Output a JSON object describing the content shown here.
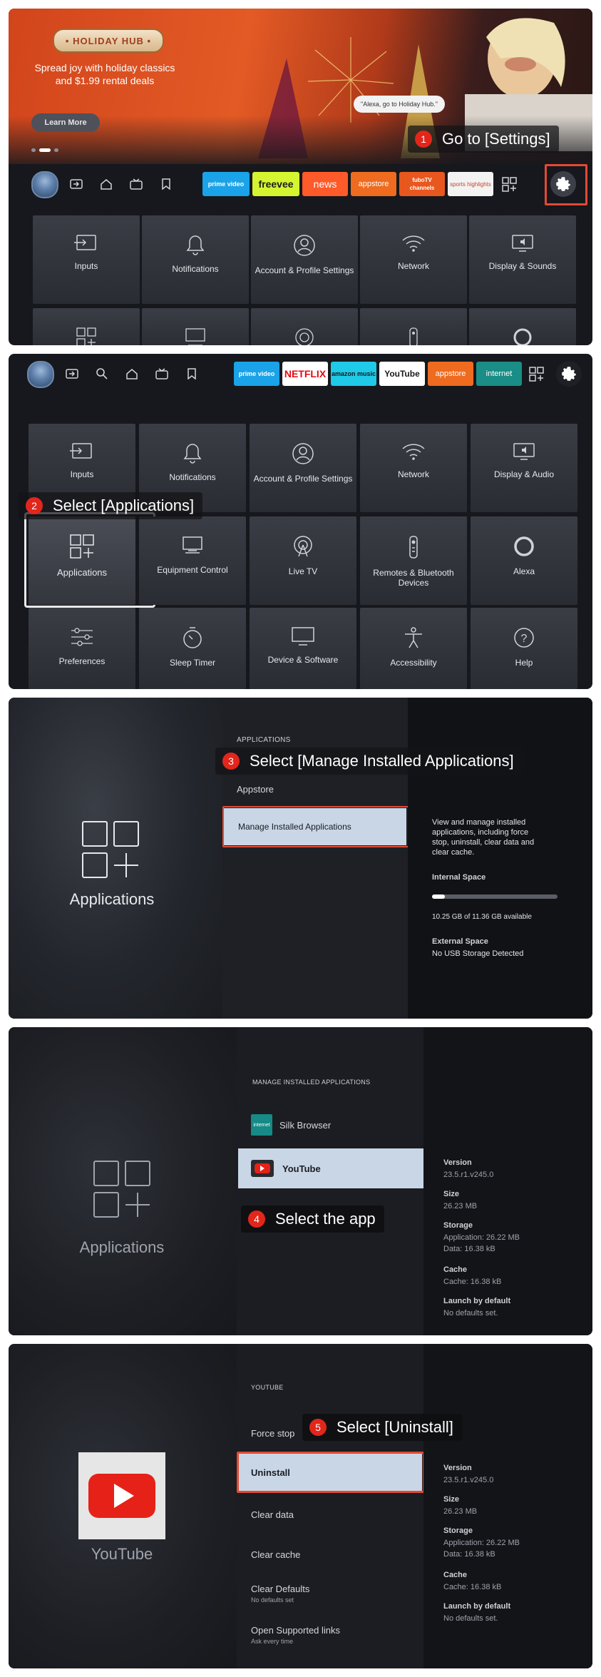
{
  "hero": {
    "badge": "• HOLIDAY HUB •",
    "subtitle_line1": "Spread joy with holiday classics",
    "subtitle_line2": "and $1.99 rental deals",
    "learn_more": "Learn More",
    "bubble": "\"Alexa, go to Holiday Hub.\""
  },
  "steps": [
    {
      "num": "1",
      "text": "Go to [Settings]"
    },
    {
      "num": "2",
      "text": "Select [Applications]"
    },
    {
      "num": "3",
      "text": "Select [Manage Installed Applications]"
    },
    {
      "num": "4",
      "text": "Select the app"
    },
    {
      "num": "5",
      "text": "Select [Uninstall]"
    }
  ],
  "nav1": {
    "chips": [
      {
        "label": "prime video",
        "color": "#1aa3e8"
      },
      {
        "label": "freevee",
        "color": "#d4f52f"
      },
      {
        "label": "news",
        "color": "#ff5a2a"
      },
      {
        "label": "appstore",
        "color": "#ee6b1f"
      },
      {
        "label": "fuboTV channels",
        "color": "#e8571e"
      },
      {
        "label": "sports highlights",
        "color": "#f3f3f3"
      }
    ]
  },
  "nav2": {
    "chips": [
      {
        "label": "prime video",
        "color": "#1aa3e8"
      },
      {
        "label": "NETFLIX",
        "color": "#ffffff"
      },
      {
        "label": "amazon music",
        "color": "#1fc9e8"
      },
      {
        "label": "YouTube",
        "color": "#ffffff"
      },
      {
        "label": "appstore",
        "color": "#ee6b1f"
      },
      {
        "label": "internet",
        "color": "#1a8d86"
      }
    ]
  },
  "tiles": {
    "inputs": "Inputs",
    "notifications": "Notifications",
    "account": "Account & Profile Settings",
    "network": "Network",
    "display_sounds": "Display & Sounds",
    "display_audio": "Display & Audio",
    "applications": "Applications",
    "equipment": "Equipment Control",
    "livetv": "Live TV",
    "remotes": "Remotes & Bluetooth Devices",
    "alexa": "Alexa",
    "preferences": "Preferences",
    "sleep": "Sleep Timer",
    "device": "Device & Software",
    "accessibility": "Accessibility",
    "help": "Help"
  },
  "apps_screen": {
    "left_label": "Applications",
    "section": "APPLICATIONS",
    "appstore": "Appstore",
    "manage": "Manage Installed Applications",
    "desc": [
      "View and manage installed",
      "applications, including force",
      "stop, uninstall, clear data and",
      "clear cache."
    ],
    "internal_h": "Internal Space",
    "storage_fraction": 0.1,
    "storage_text": "10.25 GB of 11.36 GB available",
    "external_h": "External Space",
    "external_v": "No USB Storage Detected"
  },
  "manage_screen": {
    "left_label": "Applications",
    "section": "MANAGE INSTALLED APPLICATIONS",
    "silk": "Silk Browser",
    "silk_icon_text": "internet",
    "youtube": "YouTube"
  },
  "app_info": {
    "version_h": "Version",
    "version_v": "23.5.r1.v245.0",
    "size_h": "Size",
    "size_v": "26.23 MB",
    "storage_h": "Storage",
    "storage_v1": "Application: 26.22 MB",
    "storage_v2": "Data: 16.38 kB",
    "cache_h": "Cache",
    "cache_v": "Cache: 16.38 kB",
    "launch_h": "Launch by default",
    "launch_v": "No defaults set."
  },
  "youtube_screen": {
    "left_label": "YouTube",
    "section": "YOUTUBE",
    "force_stop": "Force stop",
    "uninstall": "Uninstall",
    "clear_data": "Clear data",
    "clear_cache": "Clear cache",
    "clear_defaults": "Clear Defaults",
    "clear_defaults_sub": "No defaults set",
    "open_links": "Open Supported links",
    "open_links_sub": "Ask every time"
  },
  "colors": {
    "highlight": "#e24a33",
    "step_badge": "#e3261b",
    "selected_row": "#c9d6e6"
  }
}
